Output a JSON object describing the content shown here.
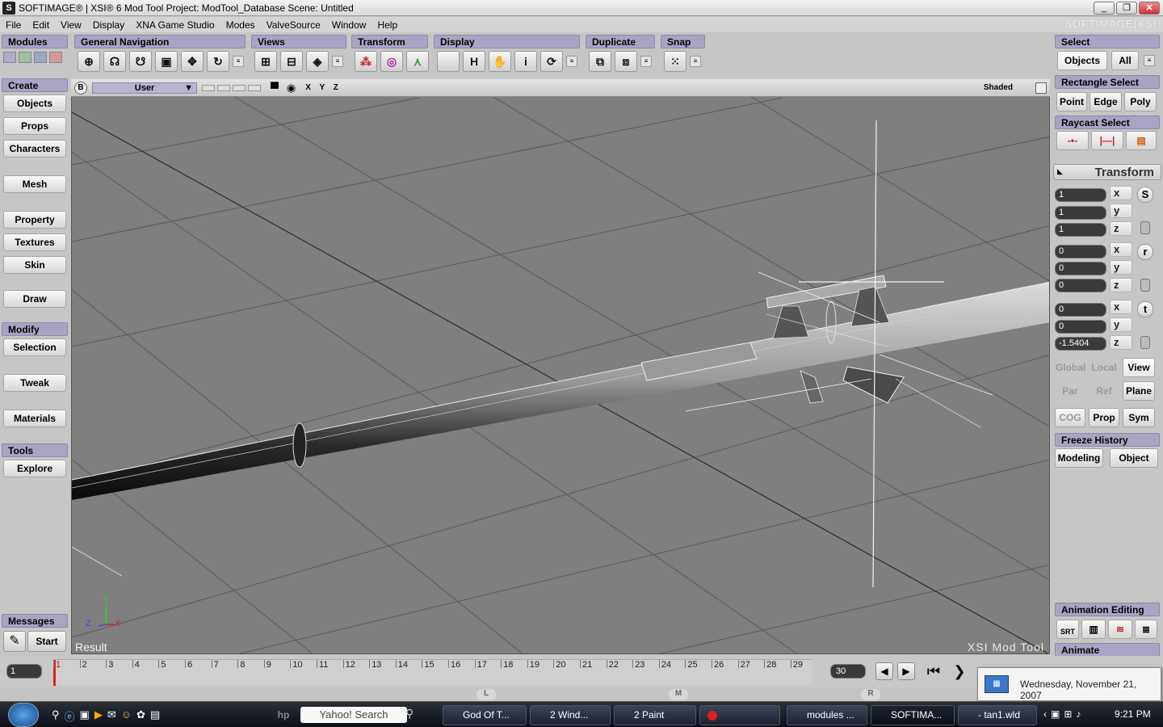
{
  "window": {
    "title": "SOFTIMAGE® | XSI® 6 Mod Tool Project: ModTool_Database     Scene: Untitled",
    "brand": "SOFTIMAGE|XSI",
    "buttons": [
      "_",
      "❐",
      "✕"
    ]
  },
  "menu": [
    "File",
    "Edit",
    "View",
    "Display",
    "XNA Game Studio",
    "Modes",
    "ValveSource",
    "Window",
    "Help"
  ],
  "toolbar": {
    "modules": "Modules",
    "groups": [
      {
        "label": "General Navigation",
        "icons": [
          "navigate-icon",
          "orbit-icon",
          "dolly-icon",
          "zoom-frame-icon",
          "pan-icon",
          "rotate-camera-icon"
        ]
      },
      {
        "label": "Views",
        "icons": [
          "schematic-icon",
          "explorer-icon",
          "render-region-icon"
        ]
      },
      {
        "label": "Transform",
        "icons": [
          "scale-icon",
          "rotate-icon",
          "translate-icon"
        ]
      },
      {
        "label": "Display",
        "icons": [
          "grid-icon",
          "hide-icon",
          "hand-icon",
          "info-icon",
          "refresh-icon"
        ],
        "texts": [
          "",
          "H",
          "",
          "i",
          ""
        ]
      },
      {
        "label": "Duplicate",
        "icons": [
          "duplicate-icon",
          "duplicate-multiple-icon"
        ]
      },
      {
        "label": "Snap",
        "icons": [
          "snap-grid-icon"
        ]
      }
    ]
  },
  "left_panel": {
    "create": "Create",
    "create_items": [
      "Objects",
      "Props",
      "Characters",
      "Mesh",
      "Property",
      "Textures",
      "Skin",
      "Draw"
    ],
    "modify": "Modify",
    "modify_items": [
      "Selection",
      "Tweak",
      "Materials"
    ],
    "tools": "Tools",
    "tools_items": [
      "Explore"
    ],
    "messages": "Messages",
    "start": "Start"
  },
  "viewport": {
    "letter": "B",
    "camera": "User",
    "axes": "X Y Z",
    "mode": "Shaded",
    "result": "Result",
    "watermark": "XSI Mod Tool",
    "gizmo": {
      "y": "Y",
      "z": "Z",
      "x": "X"
    }
  },
  "right_panel": {
    "select": "Select",
    "objects": "Objects",
    "all": "All",
    "rectangle_select": "Rectangle Select",
    "point": "Point",
    "edge": "Edge",
    "poly": "Poly",
    "raycast_select": "Raycast Select",
    "transform": "Transform",
    "scale": [
      "1",
      "1",
      "1"
    ],
    "rotate": [
      "0",
      "0",
      "0"
    ],
    "translate": [
      "0",
      "0",
      "-1.5404"
    ],
    "axis_labels": [
      "x",
      "y",
      "z"
    ],
    "srt": [
      "S",
      "r",
      "t"
    ],
    "global": "Global",
    "local": "Local",
    "view": "View",
    "par": "Par",
    "ref": "Ref",
    "plane": "Plane",
    "cog": "COG",
    "prop": "Prop",
    "sym": "Sym",
    "freeze_history": "Freeze History",
    "modeling": "Modeling",
    "object": "Object",
    "animation_editing": "Animation Editing",
    "animate": "Animate",
    "srt_label": "SRT"
  },
  "timeline": {
    "current_frame": "1",
    "ticks": [
      "1",
      "2",
      "3",
      "4",
      "5",
      "6",
      "7",
      "8",
      "9",
      "10",
      "11",
      "12",
      "13",
      "14",
      "15",
      "16",
      "17",
      "18",
      "19",
      "20",
      "21",
      "22",
      "23",
      "24",
      "25",
      "26",
      "27",
      "28",
      "29"
    ],
    "end_frame": "30",
    "markers": [
      "L",
      "M",
      "R"
    ]
  },
  "tooltip": {
    "date": "Wednesday, November 21, 2007"
  },
  "taskbar": {
    "search": "Yahoo! Search",
    "tasks": [
      "God Of T...",
      "2 Wind...",
      "2 Paint",
      "",
      "modules ...",
      "SOFTIMA...",
      "- tan1.wld"
    ],
    "time": "9:21 PM"
  },
  "colors": {
    "header": "#a9a4c3",
    "viewport": "#7d7d7d",
    "timeline_cursor": "#e02020"
  }
}
